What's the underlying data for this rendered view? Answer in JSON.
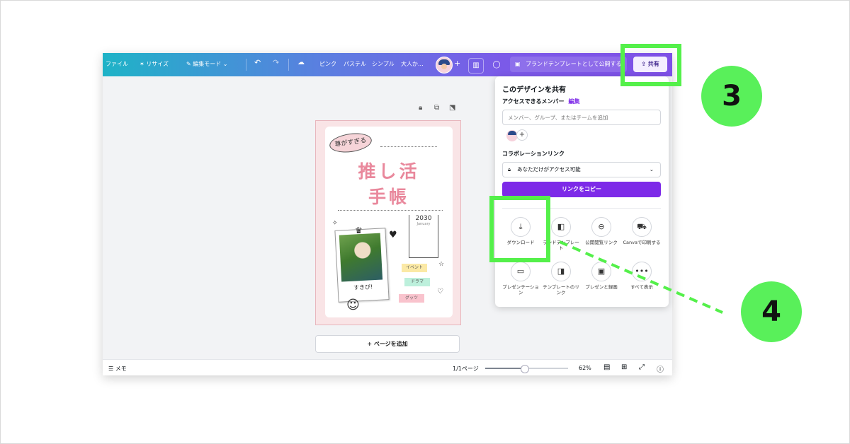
{
  "topbar": {
    "file": "ファイル",
    "resize": "リサイズ",
    "edit_mode": "編集モード",
    "tags": [
      "ピンク",
      "パステル",
      "シンプル",
      "大人か..."
    ],
    "brand_template": "ブランドテンプレートとして公開する",
    "share": "共有"
  },
  "design": {
    "bubble_text": "尊がすぎる",
    "title_line1": "推し活",
    "title_line2": "手帳",
    "year": "2030",
    "month": "January",
    "photo_caption": "すきぴ!",
    "tags": [
      "イベント",
      "ドラマ",
      "グッツ"
    ]
  },
  "canvas": {
    "add_page": "+ ページを追加"
  },
  "bottombar": {
    "notes": "メモ",
    "page_count": "1/1ページ",
    "zoom": "62%",
    "zoom_level": 0.47
  },
  "share_panel": {
    "title": "このデザインを共有",
    "access_label": "アクセスできるメンバー",
    "edit_link": "編集",
    "input_placeholder": "メンバー、グループ、またはチームを追加",
    "collab_label": "コラボレーションリンク",
    "access_value": "あなただけがアクセス可能",
    "copy_link": "リンクをコピー",
    "options": [
      {
        "label": "ダウンロード",
        "icon": "download-icon"
      },
      {
        "label": "ランドテンプレート",
        "icon": "template-icon"
      },
      {
        "label": "公開閲覧リンク",
        "icon": "link-icon"
      },
      {
        "label": "Canvaで印刷する",
        "icon": "truck-icon"
      },
      {
        "label": "プレゼンテーション",
        "icon": "presentation-icon"
      },
      {
        "label": "テンプレートのリンク",
        "icon": "template-link-icon"
      },
      {
        "label": "プレゼンと録画",
        "icon": "record-icon"
      },
      {
        "label": "すべて表示",
        "icon": "more-icon"
      }
    ]
  },
  "annotations": {
    "step3": "3",
    "step4": "4",
    "highlight_color": "#54f04a"
  }
}
